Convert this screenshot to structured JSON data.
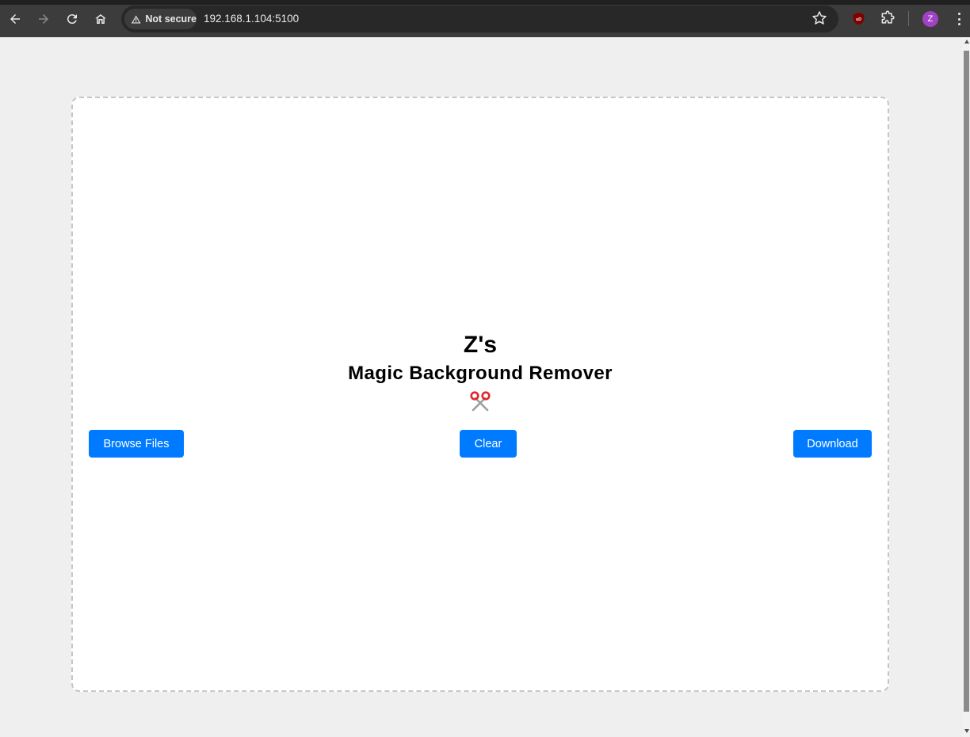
{
  "browser": {
    "security_label": "Not secure",
    "url": "192.168.1.104:5100",
    "profile_initial": "Z",
    "icons": [
      "back-arrow-icon",
      "forward-arrow-icon",
      "reload-icon",
      "home-icon",
      "warning-triangle-icon",
      "bookmark-star-icon",
      "ublock-icon",
      "extensions-puzzle-icon",
      "kebab-menu-icon"
    ]
  },
  "app": {
    "title_line1": "Z's",
    "title_line2": "Magic Background Remover",
    "title_icon": "scissors-icon",
    "buttons": {
      "browse": "Browse Files",
      "clear": "Clear",
      "download": "Download"
    },
    "accent_color": "#007bff"
  }
}
